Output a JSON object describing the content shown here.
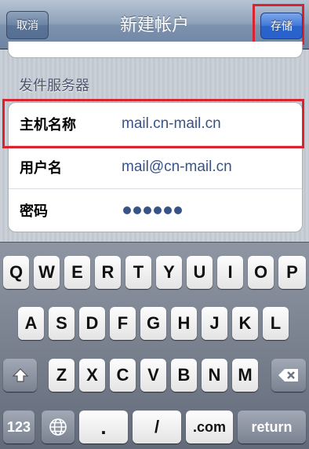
{
  "nav": {
    "title": "新建帐户",
    "cancel_label": "取消",
    "save_label": "存储"
  },
  "section": {
    "header": "发件服务器"
  },
  "fields": [
    {
      "label": "主机名称",
      "value": "mail.cn-mail.cn"
    },
    {
      "label": "用户名",
      "value": "mail@cn-mail.cn"
    },
    {
      "label": "密码",
      "masked_length": 6
    }
  ],
  "keyboard": {
    "row1": [
      "Q",
      "W",
      "E",
      "R",
      "T",
      "Y",
      "U",
      "I",
      "O",
      "P"
    ],
    "row2": [
      "A",
      "S",
      "D",
      "F",
      "G",
      "H",
      "J",
      "K",
      "L"
    ],
    "row3": [
      "Z",
      "X",
      "C",
      "V",
      "B",
      "N",
      "M"
    ],
    "bottom": {
      "numbers_label": "123",
      "dot_label": ".",
      "slash_label": "/",
      "com_label": ".com",
      "return_label": "return"
    },
    "icons": {
      "shift": "shift-icon",
      "delete": "delete-icon",
      "globe": "globe-icon"
    }
  },
  "colors": {
    "highlight": "#d9232e",
    "value_text": "#385487",
    "save_button": "#2b63cc"
  }
}
